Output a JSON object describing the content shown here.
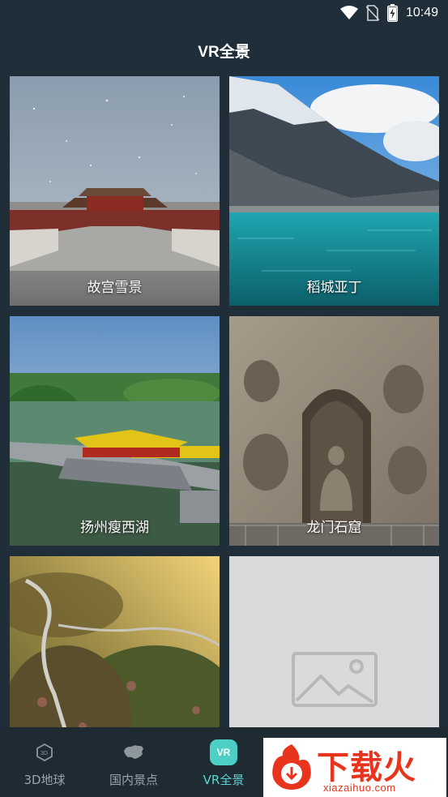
{
  "status_bar": {
    "time": "10:49",
    "icons": [
      "wifi-icon",
      "no-sim-icon",
      "battery-charging-icon"
    ]
  },
  "header": {
    "title": "VR全景"
  },
  "cards": [
    {
      "label": "故宫雪景",
      "image": "forbidden-city-snow-photo"
    },
    {
      "label": "稻城亚丁",
      "image": "daocheng-yading-lake-photo"
    },
    {
      "label": "扬州瘦西湖",
      "image": "slender-west-lake-photo"
    },
    {
      "label": "龙门石窟",
      "image": "longmen-grottoes-photo"
    },
    {
      "label": "",
      "image": "aerial-hills-road-photo"
    },
    {
      "label": "",
      "image": "image-placeholder-icon"
    }
  ],
  "bottom_nav": {
    "items": [
      {
        "label": "3D地球",
        "icon": "cube-globe-icon",
        "active": false
      },
      {
        "label": "国内景点",
        "icon": "china-map-icon",
        "active": false
      },
      {
        "label": "VR全景",
        "icon": "vr-icon",
        "icon_text": "VR",
        "active": true
      }
    ]
  },
  "watermark": {
    "text": "下载火",
    "domain": "xiazaihuo.com"
  },
  "colors": {
    "background": "#1f2e38",
    "accent": "#4ccfc5",
    "watermark_red": "#e8341c"
  }
}
